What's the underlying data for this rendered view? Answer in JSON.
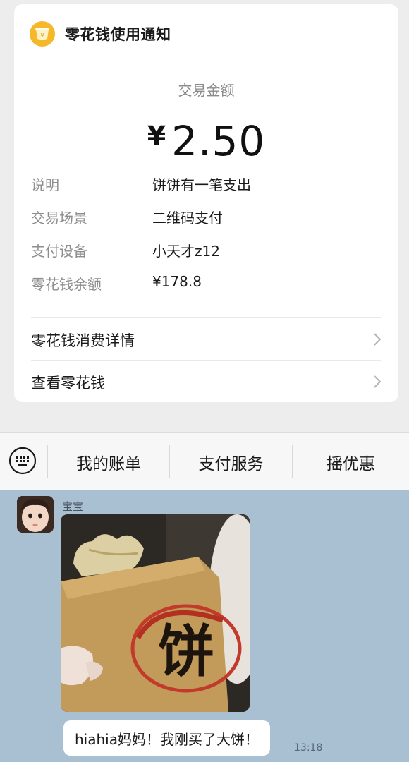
{
  "notification": {
    "app_icon": "coin-wallet-icon",
    "title": "零花钱使用通知",
    "amount_label": "交易金额",
    "currency_symbol": "¥",
    "amount": "2.50",
    "details": [
      {
        "key": "说明",
        "value": "饼饼有一笔支出"
      },
      {
        "key": "交易场景",
        "value": "二维码支付"
      },
      {
        "key": "支付设备",
        "value": "小天才z12"
      },
      {
        "key": "零花钱余额",
        "value": "¥178.8"
      }
    ],
    "links": [
      {
        "label": "零花钱消费详情",
        "icon": "chevron-right-icon"
      },
      {
        "label": "查看零花钱",
        "icon": "chevron-right-icon"
      }
    ]
  },
  "menu": {
    "keyboard_icon": "keyboard-icon",
    "items": [
      "我的账单",
      "支付服务",
      "摇优惠"
    ]
  },
  "chat": {
    "sender": "宝宝",
    "photo_text": "饼",
    "message": "hiahia妈妈！我刚买了大饼！",
    "time": "13:18"
  },
  "colors": {
    "accent_icon": "#f4b82a",
    "chat_background": "#a9c0d3",
    "page_background": "#ededed"
  }
}
